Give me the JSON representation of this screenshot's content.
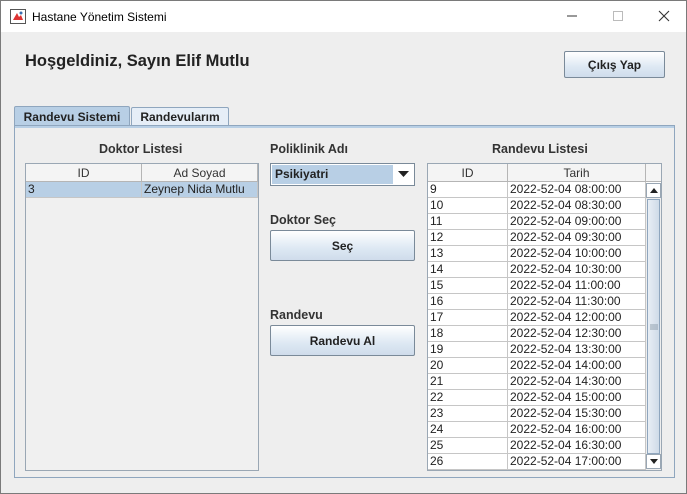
{
  "window": {
    "title": "Hastane Yönetim Sistemi"
  },
  "header": {
    "welcome": "Hoşgeldiniz, Sayın Elif Mutlu",
    "logout_label": "Çıkış Yap"
  },
  "tabs": [
    {
      "label": "Randevu Sistemi",
      "active": true
    },
    {
      "label": "Randevularım",
      "active": false
    }
  ],
  "doctor_list": {
    "title": "Doktor Listesi",
    "columns": [
      "ID",
      "Ad Soyad"
    ],
    "rows": [
      {
        "id": "3",
        "name": "Zeynep Nida Mutlu"
      }
    ]
  },
  "polyclinic": {
    "label": "Poliklinik Adı",
    "selected": "Psikiyatri"
  },
  "doctor_select": {
    "label": "Doktor Seç",
    "button_label": "Seç"
  },
  "appointment": {
    "label": "Randevu",
    "button_label": "Randevu Al"
  },
  "appointment_list": {
    "title": "Randevu Listesi",
    "columns": [
      "ID",
      "Tarih"
    ],
    "rows": [
      {
        "id": "9",
        "date": "2022-52-04 08:00:00"
      },
      {
        "id": "10",
        "date": "2022-52-04 08:30:00"
      },
      {
        "id": "11",
        "date": "2022-52-04 09:00:00"
      },
      {
        "id": "12",
        "date": "2022-52-04 09:30:00"
      },
      {
        "id": "13",
        "date": "2022-52-04 10:00:00"
      },
      {
        "id": "14",
        "date": "2022-52-04 10:30:00"
      },
      {
        "id": "15",
        "date": "2022-52-04 11:00:00"
      },
      {
        "id": "16",
        "date": "2022-52-04 11:30:00"
      },
      {
        "id": "17",
        "date": "2022-52-04 12:00:00"
      },
      {
        "id": "18",
        "date": "2022-52-04 12:30:00"
      },
      {
        "id": "19",
        "date": "2022-52-04 13:30:00"
      },
      {
        "id": "20",
        "date": "2022-52-04 14:00:00"
      },
      {
        "id": "21",
        "date": "2022-52-04 14:30:00"
      },
      {
        "id": "22",
        "date": "2022-52-04 15:00:00"
      },
      {
        "id": "23",
        "date": "2022-52-04 15:30:00"
      },
      {
        "id": "24",
        "date": "2022-52-04 16:00:00"
      },
      {
        "id": "25",
        "date": "2022-52-04 16:30:00"
      },
      {
        "id": "26",
        "date": "2022-52-04 17:00:00"
      }
    ]
  },
  "colors": {
    "accent": "#b8cfe5",
    "tab_border": "#8fa6be"
  },
  "icons": [
    "app-icon",
    "minimize-icon",
    "maximize-icon",
    "close-icon",
    "chevron-down-icon",
    "scroll-up-icon",
    "scroll-down-icon"
  ]
}
